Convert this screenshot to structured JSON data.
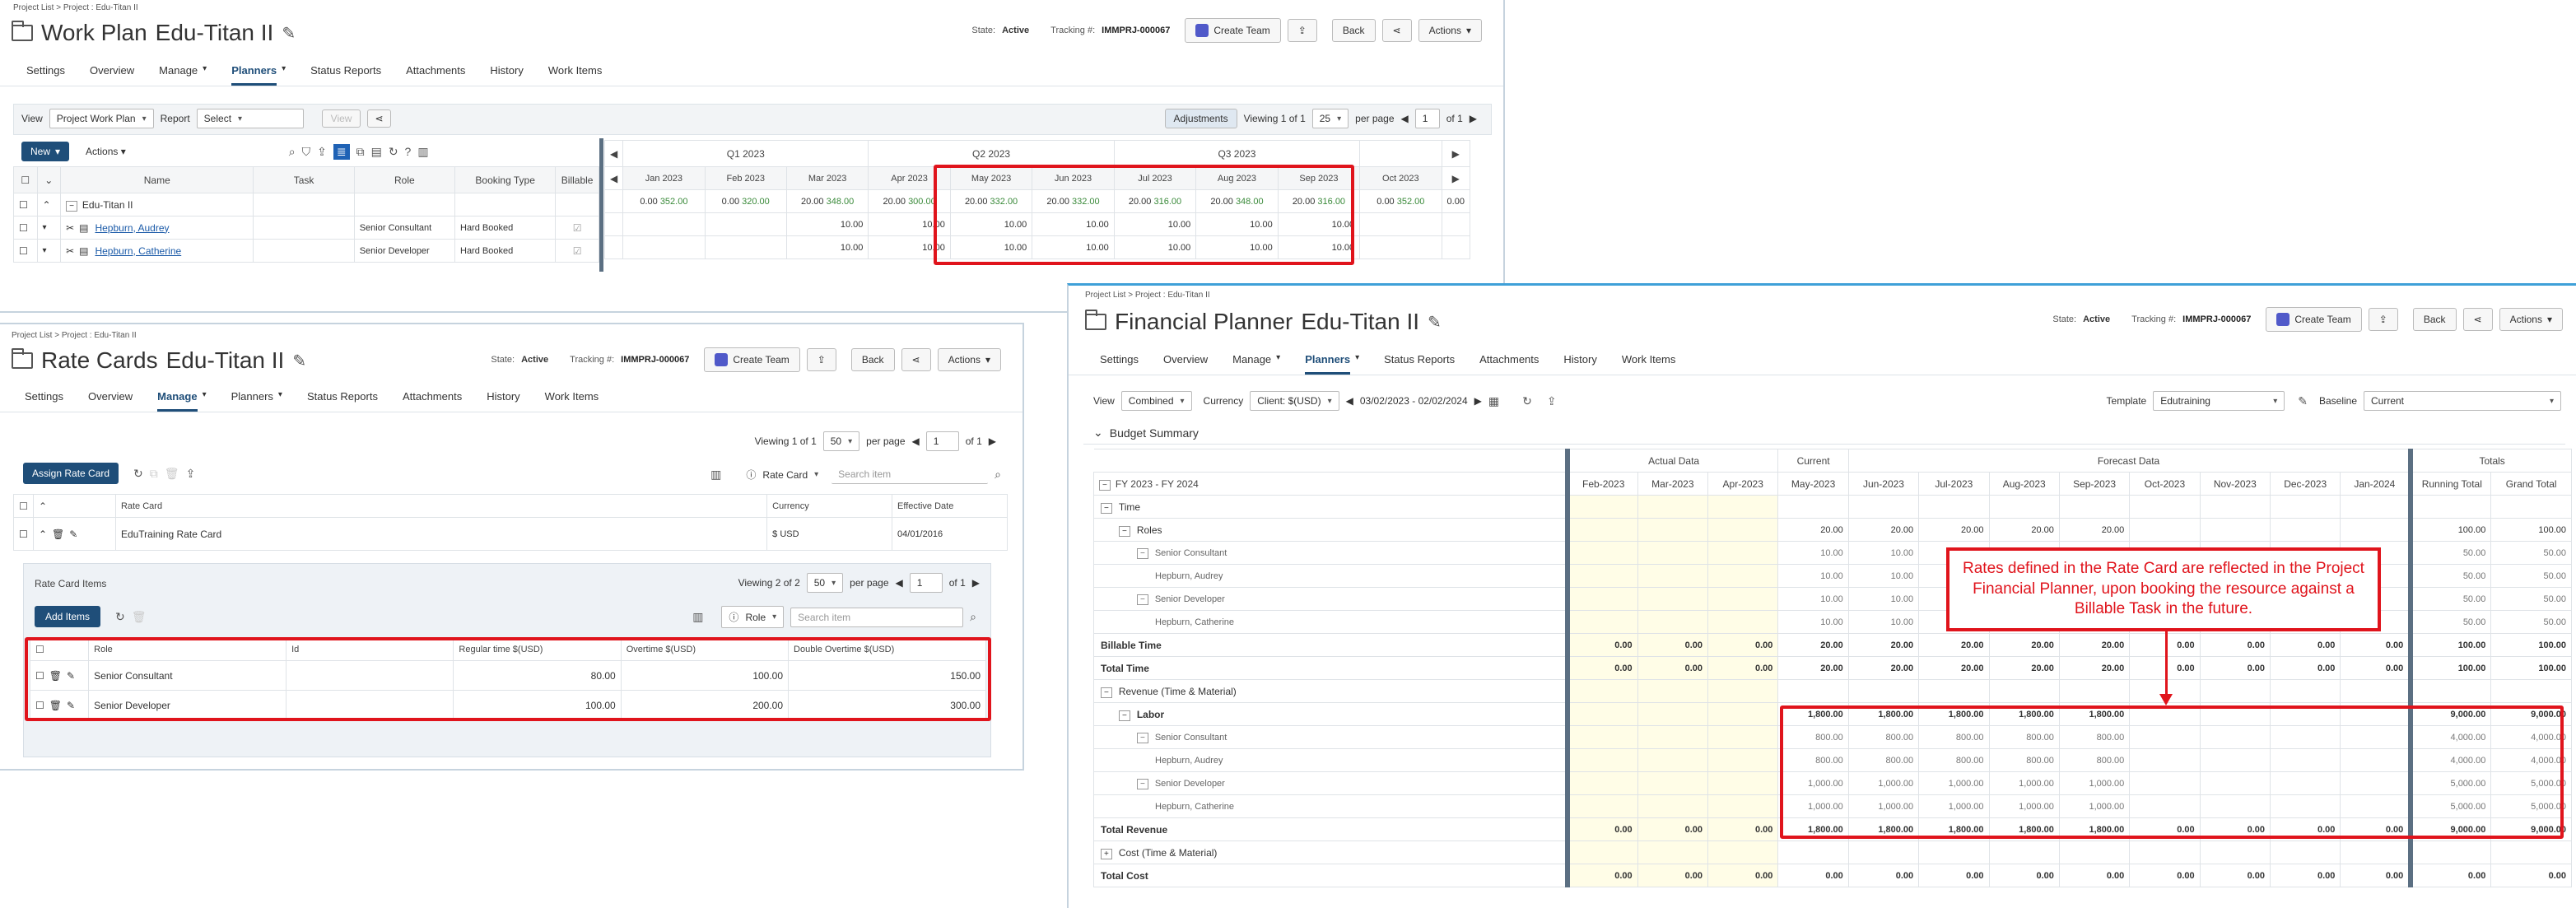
{
  "work_plan": {
    "breadcrumb": "Project List > Project : Edu-Titan II",
    "title_prefix": "Work Plan",
    "title": "Edu-Titan II",
    "state_label": "State:",
    "state": "Active",
    "tracking_label": "Tracking #:",
    "tracking": "IMMPRJ-000067",
    "create_team": "Create Team",
    "back": "Back",
    "actions": "Actions",
    "tabs": [
      "Settings",
      "Overview",
      "Manage",
      "Planners",
      "Status Reports",
      "Attachments",
      "History",
      "Work Items"
    ],
    "view_label": "View",
    "view_value": "Project Work Plan",
    "report_label": "Report",
    "report_value": "Select",
    "view_btn": "View",
    "adjustments": "Adjustments",
    "viewing": "Viewing 1 of 1",
    "per_page_value": "25",
    "per_page": "per page",
    "page": "1",
    "of": "of 1",
    "new": "New",
    "actions_menu": "Actions",
    "columns": [
      "Name",
      "Task",
      "Role",
      "Booking Type",
      "Billable"
    ],
    "quarters": [
      "Q1 2023",
      "Q2 2023",
      "Q3 2023"
    ],
    "months": [
      "Jan 2023",
      "Feb 2023",
      "Mar 2023",
      "Apr 2023",
      "May 2023",
      "Jun 2023",
      "Jul 2023",
      "Aug 2023",
      "Sep 2023",
      "Oct 2023"
    ],
    "project_row": {
      "name": "Edu-Titan II",
      "values": [
        [
          "0.00",
          "352.00"
        ],
        [
          "0.00",
          "320.00"
        ],
        [
          "20.00",
          "348.00"
        ],
        [
          "20.00",
          "300.00"
        ],
        [
          "20.00",
          "332.00"
        ],
        [
          "20.00",
          "332.00"
        ],
        [
          "20.00",
          "316.00"
        ],
        [
          "20.00",
          "348.00"
        ],
        [
          "20.00",
          "316.00"
        ],
        [
          "0.00",
          "352.00"
        ],
        [
          "0.00",
          ""
        ]
      ]
    },
    "resources": [
      {
        "name": "Hepburn, Audrey",
        "role": "Senior Consultant",
        "booking": "Hard Booked",
        "values": [
          "",
          "",
          "10.00",
          "10.00",
          "10.00",
          "10.00",
          "10.00",
          "10.00",
          "10.00",
          "",
          ""
        ]
      },
      {
        "name": "Hepburn, Catherine",
        "role": "Senior Developer",
        "booking": "Hard Booked",
        "values": [
          "",
          "",
          "10.00",
          "10.00",
          "10.00",
          "10.00",
          "10.00",
          "10.00",
          "10.00",
          "",
          ""
        ]
      }
    ]
  },
  "rate_cards": {
    "breadcrumb": "Project List > Project : Edu-Titan II",
    "title_prefix": "Rate Cards",
    "title": "Edu-Titan II",
    "state_label": "State:",
    "state": "Active",
    "tracking_label": "Tracking #:",
    "tracking": "IMMPRJ-000067",
    "create_team": "Create Team",
    "back": "Back",
    "actions": "Actions",
    "tabs": [
      "Settings",
      "Overview",
      "Manage",
      "Planners",
      "Status Reports",
      "Attachments",
      "History",
      "Work Items"
    ],
    "viewing": "Viewing 1 of 1",
    "per_page_value": "50",
    "per_page": "per page",
    "page": "1",
    "of": "of 1",
    "assign": "Assign Rate Card",
    "search_filter": "Rate Card",
    "search_placeholder": "Search item",
    "columns": [
      "Rate Card",
      "Currency",
      "Effective Date"
    ],
    "card_row": {
      "name": "EduTraining Rate Card",
      "currency": "$ USD",
      "date": "04/01/2016"
    },
    "items_title": "Rate Card Items",
    "items_viewing": "Viewing 2 of 2",
    "items_per_page_value": "50",
    "items_page": "1",
    "items_of": "of 1",
    "add_items": "Add Items",
    "items_filter": "Role",
    "items_search": "Search item",
    "item_columns": [
      "Role",
      "Id",
      "Regular time $(USD)",
      "Overtime $(USD)",
      "Double Overtime $(USD)"
    ],
    "items": [
      {
        "role": "Senior Consultant",
        "id": "",
        "regular": "80.00",
        "overtime": "100.00",
        "double": "150.00"
      },
      {
        "role": "Senior Developer",
        "id": "",
        "regular": "100.00",
        "overtime": "200.00",
        "double": "300.00"
      }
    ]
  },
  "financial": {
    "breadcrumb": "Project List > Project : Edu-Titan II",
    "title_prefix": "Financial Planner",
    "title": "Edu-Titan II",
    "state_label": "State:",
    "state": "Active",
    "tracking_label": "Tracking #:",
    "tracking": "IMMPRJ-000067",
    "create_team": "Create Team",
    "back": "Back",
    "actions": "Actions",
    "tabs": [
      "Settings",
      "Overview",
      "Manage",
      "Planners",
      "Status Reports",
      "Attachments",
      "History",
      "Work Items"
    ],
    "view_label": "View",
    "view_value": "Combined",
    "currency_label": "Currency",
    "currency_value": "Client: $(USD)",
    "range": "03/02/2023 - 02/02/2024",
    "template_label": "Template",
    "template_value": "Edutraining",
    "baseline_label": "Baseline",
    "baseline_value": "Current",
    "section": "Budget Summary",
    "groups": {
      "actual": "Actual Data",
      "current": "Current",
      "forecast": "Forecast Data",
      "totals": "Totals"
    },
    "fy": "FY 2023 - FY 2024",
    "months": [
      "Feb-2023",
      "Mar-2023",
      "Apr-2023",
      "May-2023",
      "Jun-2023",
      "Jul-2023",
      "Aug-2023",
      "Sep-2023",
      "Oct-2023",
      "Nov-2023",
      "Dec-2023",
      "Jan-2024"
    ],
    "total_cols": [
      "Running Total",
      "Grand Total"
    ],
    "rows": [
      {
        "label": "Time",
        "indent": 0,
        "bold": false,
        "toggle": "−",
        "cells": [
          "",
          "",
          "",
          "",
          "",
          "",
          "",
          "",
          "",
          "",
          "",
          ""
        ],
        "tot": [
          "",
          ""
        ]
      },
      {
        "label": "Roles",
        "indent": 1,
        "bold": false,
        "toggle": "−",
        "cells": [
          "",
          "",
          "",
          "20.00",
          "20.00",
          "20.00",
          "20.00",
          "20.00",
          "",
          "",
          "",
          ""
        ],
        "tot": [
          "100.00",
          "100.00"
        ]
      },
      {
        "label": "Senior Consultant",
        "indent": 2,
        "bold": false,
        "toggle": "−",
        "light": true,
        "cells": [
          "",
          "",
          "",
          "10.00",
          "10.00",
          "",
          "",
          "",
          "",
          "",
          "",
          ""
        ],
        "tot": [
          "50.00",
          "50.00"
        ]
      },
      {
        "label": "Hepburn, Audrey",
        "indent": 3,
        "bold": false,
        "light": true,
        "cells": [
          "",
          "",
          "",
          "10.00",
          "10.00",
          "",
          "",
          "",
          "",
          "",
          "",
          ""
        ],
        "tot": [
          "50.00",
          "50.00"
        ]
      },
      {
        "label": "Senior Developer",
        "indent": 2,
        "bold": false,
        "toggle": "−",
        "light": true,
        "cells": [
          "",
          "",
          "",
          "10.00",
          "10.00",
          "",
          "",
          "",
          "",
          "",
          "",
          ""
        ],
        "tot": [
          "50.00",
          "50.00"
        ]
      },
      {
        "label": "Hepburn, Catherine",
        "indent": 3,
        "bold": false,
        "light": true,
        "cells": [
          "",
          "",
          "",
          "10.00",
          "10.00",
          "",
          "",
          "",
          "",
          "",
          "",
          ""
        ],
        "tot": [
          "50.00",
          "50.00"
        ]
      },
      {
        "label": "Billable Time",
        "indent": 0,
        "bold": true,
        "cells": [
          "0.00",
          "0.00",
          "0.00",
          "20.00",
          "20.00",
          "20.00",
          "20.00",
          "20.00",
          "0.00",
          "0.00",
          "0.00",
          "0.00"
        ],
        "tot": [
          "100.00",
          "100.00"
        ]
      },
      {
        "label": "Total Time",
        "indent": 0,
        "bold": true,
        "cells": [
          "0.00",
          "0.00",
          "0.00",
          "20.00",
          "20.00",
          "20.00",
          "20.00",
          "20.00",
          "0.00",
          "0.00",
          "0.00",
          "0.00"
        ],
        "tot": [
          "100.00",
          "100.00"
        ]
      },
      {
        "label": "Revenue (Time & Material)",
        "indent": 0,
        "bold": false,
        "toggle": "−",
        "cells": [
          "",
          "",
          "",
          "",
          "",
          "",
          "",
          "",
          "",
          "",
          "",
          ""
        ],
        "tot": [
          "",
          ""
        ]
      },
      {
        "label": "Labor",
        "indent": 1,
        "bold": true,
        "toggle": "−",
        "cells": [
          "",
          "",
          "",
          "1,800.00",
          "1,800.00",
          "1,800.00",
          "1,800.00",
          "1,800.00",
          "",
          "",
          "",
          ""
        ],
        "tot": [
          "9,000.00",
          "9,000.00"
        ]
      },
      {
        "label": "Senior Consultant",
        "indent": 2,
        "bold": false,
        "toggle": "−",
        "light": true,
        "cells": [
          "",
          "",
          "",
          "800.00",
          "800.00",
          "800.00",
          "800.00",
          "800.00",
          "",
          "",
          "",
          ""
        ],
        "tot": [
          "4,000.00",
          "4,000.00"
        ]
      },
      {
        "label": "Hepburn, Audrey",
        "indent": 3,
        "bold": false,
        "light": true,
        "cells": [
          "",
          "",
          "",
          "800.00",
          "800.00",
          "800.00",
          "800.00",
          "800.00",
          "",
          "",
          "",
          ""
        ],
        "tot": [
          "4,000.00",
          "4,000.00"
        ]
      },
      {
        "label": "Senior Developer",
        "indent": 2,
        "bold": false,
        "toggle": "−",
        "light": true,
        "cells": [
          "",
          "",
          "",
          "1,000.00",
          "1,000.00",
          "1,000.00",
          "1,000.00",
          "1,000.00",
          "",
          "",
          "",
          ""
        ],
        "tot": [
          "5,000.00",
          "5,000.00"
        ]
      },
      {
        "label": "Hepburn, Catherine",
        "indent": 3,
        "bold": false,
        "light": true,
        "cells": [
          "",
          "",
          "",
          "1,000.00",
          "1,000.00",
          "1,000.00",
          "1,000.00",
          "1,000.00",
          "",
          "",
          "",
          ""
        ],
        "tot": [
          "5,000.00",
          "5,000.00"
        ]
      },
      {
        "label": "Total Revenue",
        "indent": 0,
        "bold": true,
        "cells": [
          "0.00",
          "0.00",
          "0.00",
          "1,800.00",
          "1,800.00",
          "1,800.00",
          "1,800.00",
          "1,800.00",
          "0.00",
          "0.00",
          "0.00",
          "0.00"
        ],
        "tot": [
          "9,000.00",
          "9,000.00"
        ]
      },
      {
        "label": "Cost (Time & Material)",
        "indent": 0,
        "bold": false,
        "toggle": "+",
        "cells": [
          "",
          "",
          "",
          "",
          "",
          "",
          "",
          "",
          "",
          "",
          "",
          ""
        ],
        "tot": [
          "",
          ""
        ]
      },
      {
        "label": "Total Cost",
        "indent": 0,
        "bold": true,
        "cells": [
          "0.00",
          "0.00",
          "0.00",
          "0.00",
          "0.00",
          "0.00",
          "0.00",
          "0.00",
          "0.00",
          "0.00",
          "0.00",
          "0.00"
        ],
        "tot": [
          "0.00",
          "0.00"
        ]
      }
    ],
    "callout": "Rates defined in the Rate Card are reflected in the Project Financial Planner, upon booking the resource against a Billable Task in the future."
  }
}
